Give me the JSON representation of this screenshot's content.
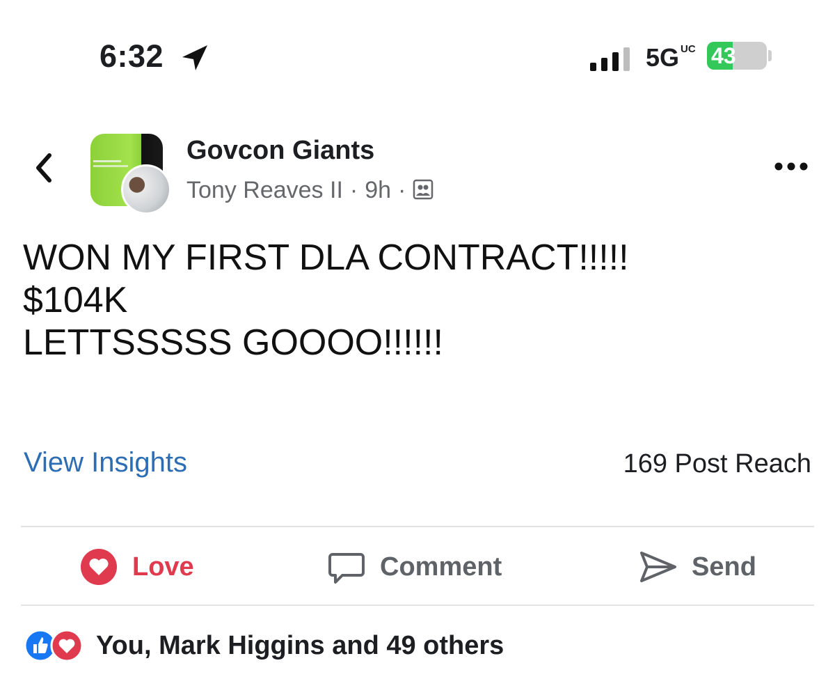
{
  "status_bar": {
    "time": "6:32",
    "network": "5G",
    "network_suffix": "UC",
    "battery_percent": "43",
    "battery_level": 0.43,
    "location_icon": "location-arrow-icon",
    "signal_icon": "signal-bars-icon"
  },
  "header": {
    "group_name": "Govcon Giants",
    "author": "Tony Reaves II",
    "time_ago": "9h",
    "separator": "·",
    "audience_icon": "group-members-icon"
  },
  "post": {
    "lines": [
      "WON MY FIRST DLA CONTRACT!!!!!",
      "$104K",
      "LETTSSSSS GOOOO!!!!!!"
    ]
  },
  "insights": {
    "link": "View Insights",
    "reach": "169 Post Reach"
  },
  "actions": {
    "love": "Love",
    "comment": "Comment",
    "send": "Send"
  },
  "reactions": {
    "summary": "You, Mark Higgins and 49 others"
  },
  "colors": {
    "link_blue": "#2d6db3",
    "love_red": "#e03a4e",
    "like_blue": "#1877f2",
    "battery_green": "#34c759"
  }
}
